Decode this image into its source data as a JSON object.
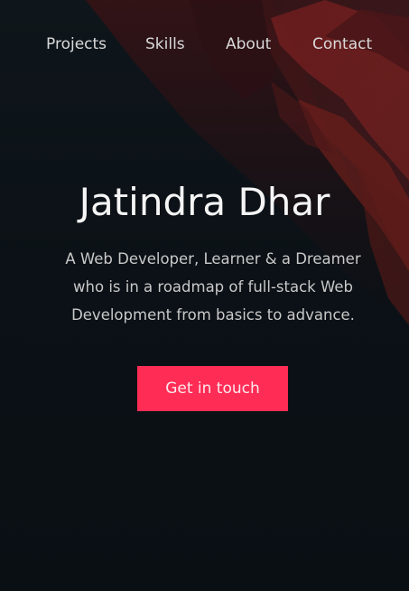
{
  "nav": {
    "items": [
      {
        "label": "Projects"
      },
      {
        "label": "Skills"
      },
      {
        "label": "About"
      },
      {
        "label": "Contact"
      }
    ]
  },
  "hero": {
    "name": "Jatindra Dhar",
    "description_lines": [
      "A Web Developer, Learner & a Dreamer",
      "who is in a roadmap of full-stack Web",
      "Development from basics to advance."
    ],
    "cta_label": "Get in touch"
  },
  "colors": {
    "background": "#0b1116",
    "accent": "#ff2d55",
    "art": "#7a1f1f"
  }
}
